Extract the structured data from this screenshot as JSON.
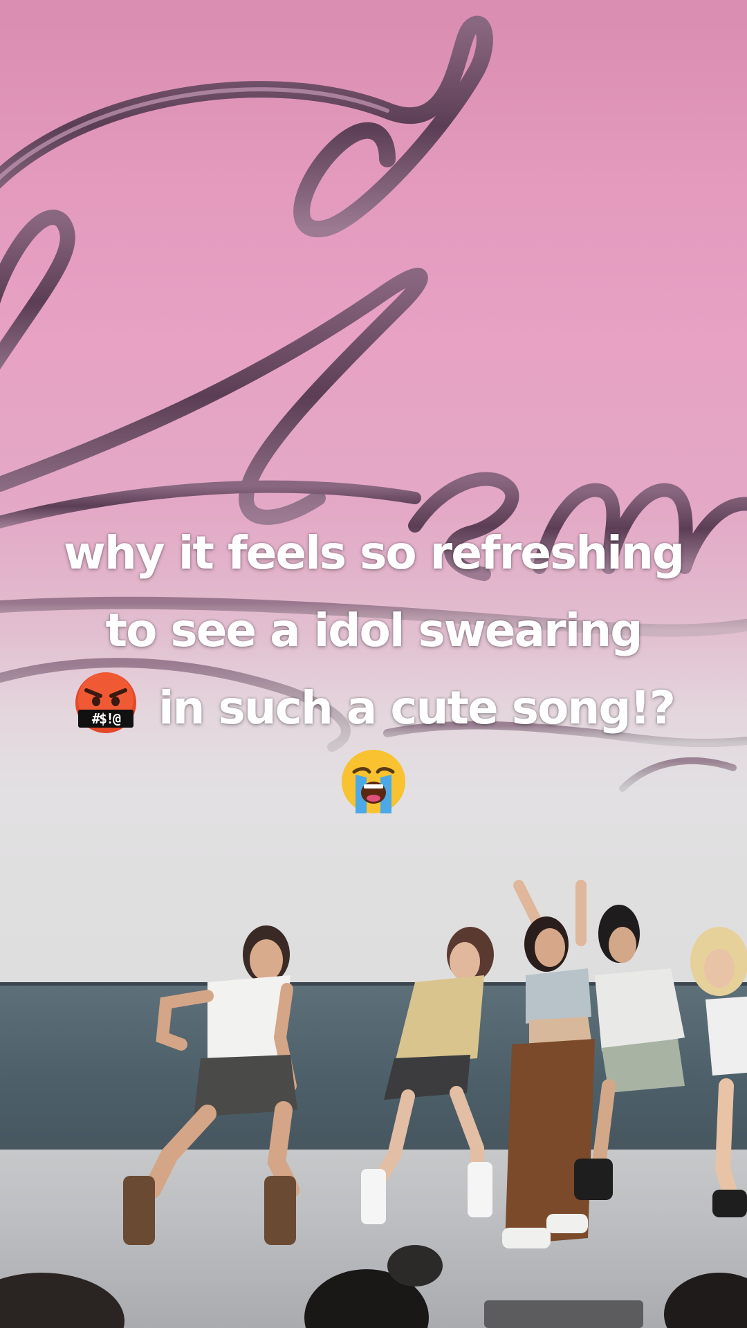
{
  "caption": {
    "line1": "why it feels so refreshing",
    "line2": "to see a idol swearing",
    "line3": "in such a cute song!?",
    "symbols_text": "#$!@"
  },
  "icons": {
    "swearing": "face-with-symbols-on-mouth-icon",
    "crying": "loudly-crying-face-icon"
  },
  "colors": {
    "backdrop_pink": "#e39abd",
    "logo_chrome": "#6e4d66",
    "stage_wall": "#4c5f69",
    "caption_text": "#ffffff"
  }
}
